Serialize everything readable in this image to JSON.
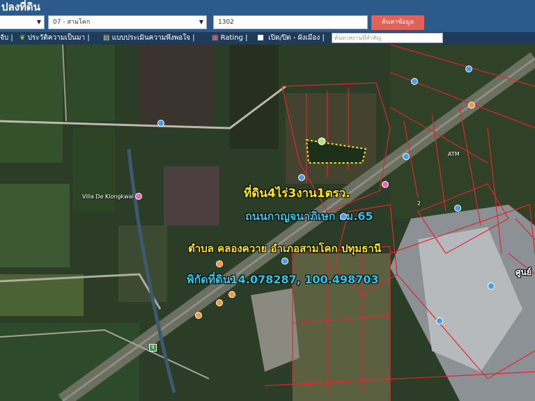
{
  "header": {
    "title": "ปลงที่ดิน",
    "province_select": "",
    "district_select": "07 - สามโคก",
    "parcel_input": "1302",
    "search_button": "ค้นหาข้อมูล"
  },
  "toolbar": {
    "item0": "จับ",
    "item1": "ประวัติความเป็นมา",
    "item2": "แบบประเมินความพึงพอใจ",
    "item3": "Rating",
    "item4": "เปิด/ปิด - ผังเมือง",
    "search_placeholder": "ค้นหาสถานที่สำคัญ"
  },
  "map": {
    "headline": "ที่ดิน4ไร่3งาน1ตรว.",
    "road": "ถนนกาญจนาภิเษก กม.65",
    "address": "ตำบล คลองควาย อำเภอสามโคก ปทุมธานี",
    "coords": "พิกัดที่ดิน14.078287, 100.498703",
    "labels": {
      "villa": "Villa De Klongkwai",
      "route": "9",
      "edge": "ศูนย์",
      "atm": "ATM",
      "cell": "2"
    },
    "colors": {
      "parcel_line": "#e0262c",
      "headline": "#ffe817",
      "road_text": "#31c8e8",
      "address_text": "#ffe817",
      "coord_text": "#31c8e8"
    }
  }
}
